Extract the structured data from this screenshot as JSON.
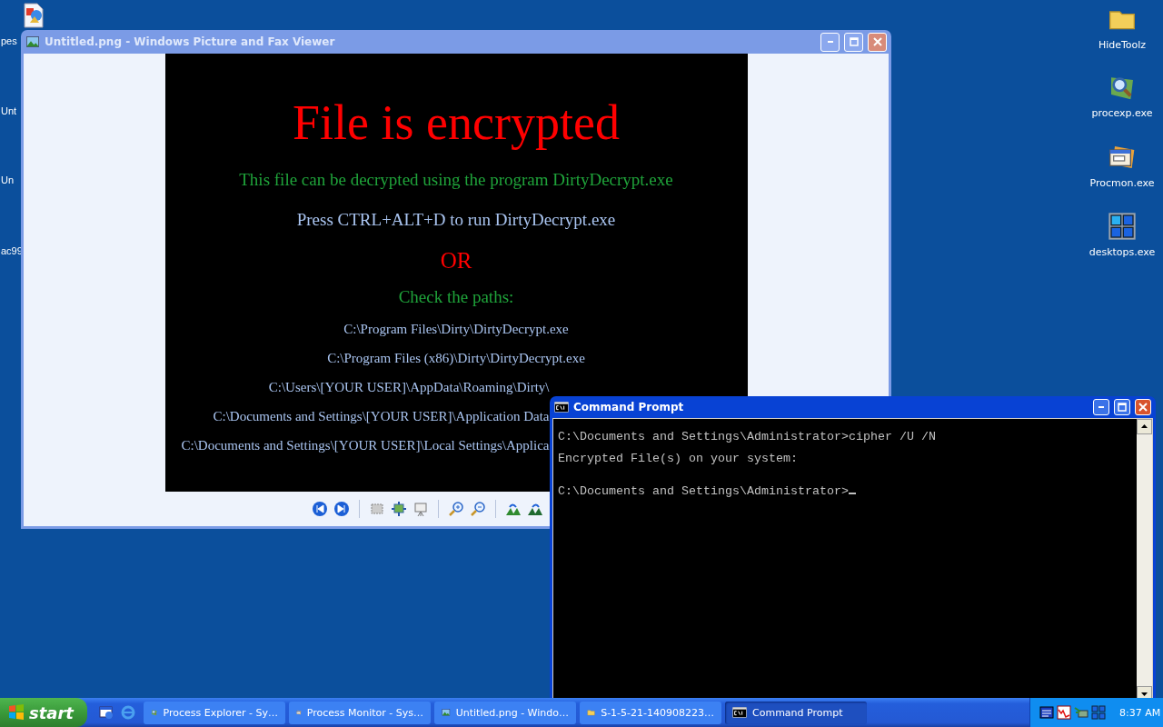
{
  "desktop_left": [
    {
      "label": "pes"
    },
    {
      "label": "Unt"
    },
    {
      "label": "Un"
    },
    {
      "label": "ac99"
    }
  ],
  "desktop_right": [
    {
      "kind": "folder",
      "label": "HideToolz"
    },
    {
      "kind": "explorer",
      "label": "procexp.exe"
    },
    {
      "kind": "monitor",
      "label": "Procmon.exe"
    },
    {
      "kind": "grid",
      "label": "desktops.exe"
    }
  ],
  "viewer": {
    "title": "Untitled.png - Windows Picture and Fax Viewer",
    "active": false,
    "image_lines": [
      {
        "kind": "headline",
        "color": "#ff0000",
        "text": "File is encrypted"
      },
      {
        "kind": "note",
        "color": "#1fa33a",
        "text": "This file can be decrypted using the program DirtyDecrypt.exe"
      },
      {
        "kind": "note",
        "color": "#a9c4f0",
        "text": "Press CTRL+ALT+D to run DirtyDecrypt.exe"
      },
      {
        "kind": "or",
        "color": "#ff0000",
        "text": "OR"
      },
      {
        "kind": "heading",
        "color": "#1fa33a",
        "text": "Check the paths:"
      },
      {
        "kind": "path",
        "color": "#a9c4f0",
        "text": "C:\\Program Files\\Dirty\\DirtyDecrypt.exe"
      },
      {
        "kind": "path",
        "color": "#a9c4f0",
        "text": "C:\\Program Files (x86)\\Dirty\\DirtyDecrypt.exe"
      },
      {
        "kind": "cut",
        "color": "#a9c4f0",
        "text": "C:\\Users\\[YOUR USER]\\AppData\\Roaming\\Dirty\\"
      },
      {
        "kind": "cut",
        "color": "#a9c4f0",
        "text": "C:\\Documents and Settings\\[YOUR USER]\\Application Data"
      },
      {
        "kind": "cut",
        "color": "#a9c4f0",
        "text": "C:\\Documents and Settings\\[YOUR USER]\\Local Settings\\Applica"
      }
    ]
  },
  "console": {
    "title": "Command Prompt",
    "active": true,
    "cursor": true,
    "blocks": [
      [
        "C:\\Documents and Settings\\Administrator>cipher /U /N",
        "Encrypted File(s) on your system:"
      ],
      [
        "C:\\Documents and Settings\\Administrator>"
      ]
    ]
  },
  "taskbar": {
    "start": "start",
    "tasks": [
      {
        "kind": "explorer",
        "label": "Process Explorer - Sy…",
        "selected": false
      },
      {
        "kind": "monitor",
        "label": "Process Monitor - Sys…",
        "selected": false
      },
      {
        "kind": "picture",
        "label": "Untitled.png - Windo…",
        "selected": false
      },
      {
        "kind": "folder",
        "label": "S-1-5-21-140908223…",
        "selected": false
      },
      {
        "kind": "console",
        "label": "Command Prompt",
        "selected": true
      }
    ],
    "clock": "8:37 AM"
  }
}
